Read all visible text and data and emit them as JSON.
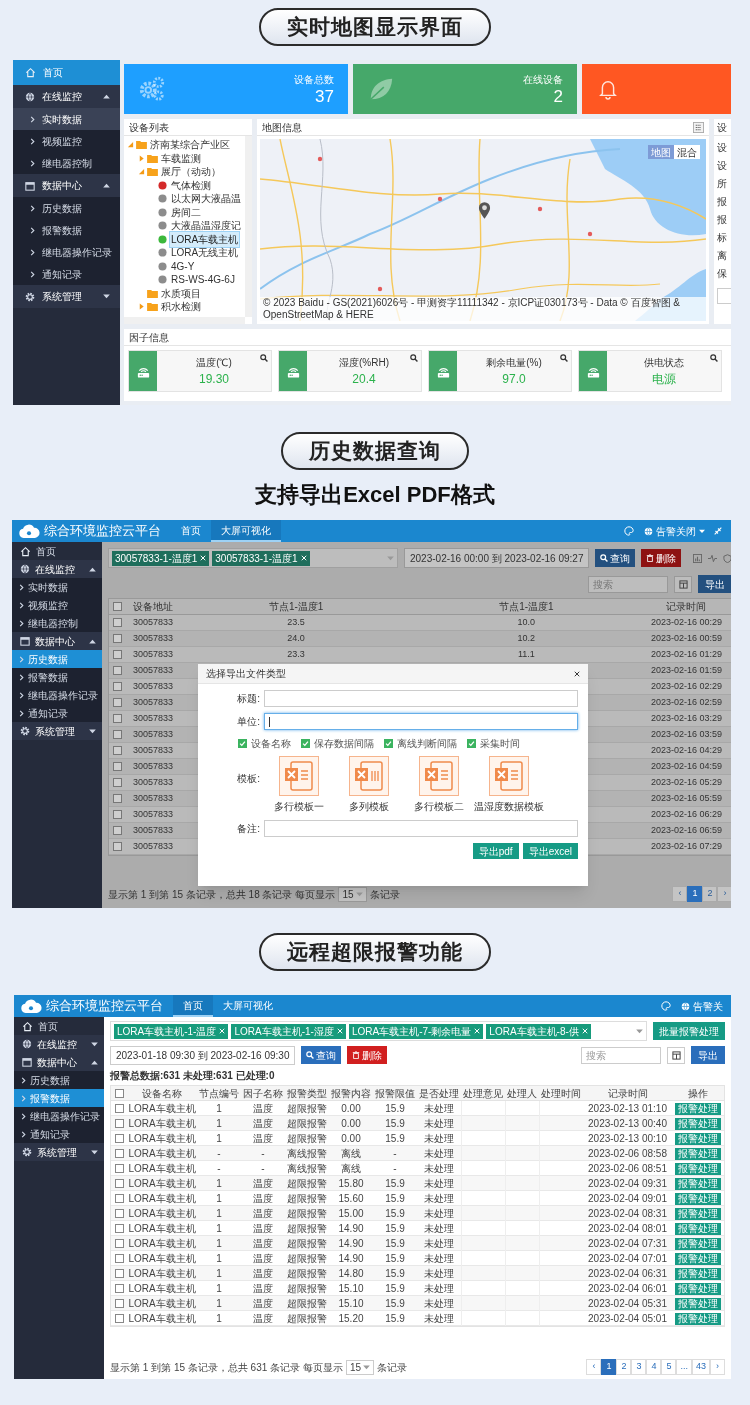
{
  "map_screen": {
    "heading": "实时地图显示界面",
    "sidebar": [
      {
        "kind": "link",
        "label": "首页"
      },
      {
        "kind": "group",
        "label": "在线监控",
        "expanded": true,
        "children": [
          {
            "label": "实时数据",
            "selected": true
          },
          {
            "label": "视频监控",
            "selected": false
          },
          {
            "label": "继电器控制",
            "selected": false
          }
        ]
      },
      {
        "kind": "group",
        "label": "数据中心",
        "expanded": true,
        "children": [
          {
            "label": "历史数据",
            "selected": false
          },
          {
            "label": "报警数据",
            "selected": false
          },
          {
            "label": "继电器操作记录",
            "selected": false
          },
          {
            "label": "通知记录",
            "selected": false
          }
        ]
      },
      {
        "kind": "group",
        "label": "系统管理",
        "expanded": false
      }
    ],
    "stats": [
      {
        "label": "设备总数",
        "value": "37",
        "color": "#1e9fff"
      },
      {
        "label": "在线设备",
        "value": "2",
        "color": "#46a86a"
      },
      {
        "color": "#ff5722"
      }
    ],
    "device_list": {
      "title": "设备列表",
      "tree": [
        {
          "kind": "folder",
          "label": "济南某综合产业区",
          "expanded": true,
          "children": [
            {
              "kind": "folder",
              "label": "车载监测",
              "expanded": false
            },
            {
              "kind": "folder",
              "label": "展厅（动动）",
              "expanded": true,
              "children": [
                {
                  "kind": "device",
                  "label": "气体检测",
                  "color": "#d42a2a",
                  "selected": false
                },
                {
                  "kind": "device",
                  "label": "以太网大液晶温",
                  "color": "#8c8c8c",
                  "selected": false
                },
                {
                  "kind": "device",
                  "label": "房间二",
                  "color": "#8c8c8c",
                  "selected": false
                },
                {
                  "kind": "device",
                  "label": "大液晶温湿度记",
                  "color": "#8c8c8c",
                  "selected": false
                },
                {
                  "kind": "device",
                  "label": "LORA车载主机",
                  "color": "#3cb83c",
                  "selected": true
                },
                {
                  "kind": "device",
                  "label": "LORA无线主机",
                  "color": "#8c8c8c",
                  "selected": false
                },
                {
                  "kind": "device",
                  "label": "4G-Y",
                  "color": "#8c8c8c",
                  "selected": false
                },
                {
                  "kind": "device",
                  "label": "RS-WS-4G-6J",
                  "color": "#8c8c8c",
                  "selected": false
                }
              ]
            },
            {
              "kind": "folder",
              "label": "水质项目"
            },
            {
              "kind": "folder",
              "label": "积水检测",
              "expanded": false
            }
          ]
        }
      ]
    },
    "map": {
      "title": "地图信息",
      "map_types": [
        {
          "label": "地图",
          "selected": true
        },
        {
          "label": "混合",
          "selected": false
        }
      ],
      "attribution": "© 2023 Baidu - GS(2021)6026号 - 甲测资字11111342 - 京ICP证030173号 - Data © 百度智图 & OpenStreetMap & HERE"
    },
    "detail_panel": {
      "title": "设",
      "labels": [
        "设",
        "设",
        "所",
        "报",
        "报",
        "标",
        "离",
        "保"
      ]
    },
    "factors": {
      "title": "因子信息",
      "cards": [
        {
          "label": "温度(℃)",
          "value": "19.30"
        },
        {
          "label": "湿度(%RH)",
          "value": "20.4"
        },
        {
          "label": "剩余电量(%)",
          "value": "97.0"
        },
        {
          "label": "供电状态",
          "value": "电源"
        }
      ]
    }
  },
  "history_screen": {
    "heading": "历史数据查询",
    "subtitle": "支持导出Excel PDF格式",
    "app_title": "综合环境监控云平台",
    "nav": [
      {
        "label": "首页",
        "selected": false
      },
      {
        "label": "大屏可视化",
        "selected": true
      }
    ],
    "alarm_toggle": "告警关闭",
    "sidebar": [
      {
        "kind": "link",
        "label": "首页"
      },
      {
        "kind": "group",
        "label": "在线监控",
        "expanded": true,
        "children": [
          {
            "label": "实时数据",
            "selected": false
          },
          {
            "label": "视频监控",
            "selected": false
          },
          {
            "label": "继电器控制",
            "selected": false
          }
        ]
      },
      {
        "kind": "group",
        "label": "数据中心",
        "expanded": true,
        "children": [
          {
            "label": "历史数据",
            "selected": true
          },
          {
            "label": "报警数据",
            "selected": false
          },
          {
            "label": "继电器操作记录",
            "selected": false
          },
          {
            "label": "通知记录",
            "selected": false
          }
        ]
      },
      {
        "kind": "group",
        "label": "系统管理",
        "expanded": false
      }
    ],
    "filter": {
      "tags": [
        "30057833-1-温度1",
        "30057833-1-温度1"
      ],
      "date_range": "2023-02-16 00:00 到 2023-02-16 09:27",
      "query_button": "查询",
      "delete_button": "删除"
    },
    "search": {
      "placeholder": "搜索"
    },
    "export_button": "导出",
    "table": {
      "select_all_checked": false,
      "columns": [
        "设备地址",
        "节点1-温度1",
        "节点1-温度1",
        "记录时间"
      ],
      "rows": [
        {
          "checked": false,
          "address": "30057833",
          "readings": [
            "23.5",
            "10.0"
          ],
          "time": "2023-02-16 00:29"
        },
        {
          "checked": false,
          "address": "30057833",
          "readings": [
            "24.0",
            "10.2"
          ],
          "time": "2023-02-16 00:59"
        },
        {
          "checked": false,
          "address": "30057833",
          "readings": [
            "23.3",
            "11.1"
          ],
          "time": "2023-02-16 01:29"
        },
        {
          "checked": false,
          "address": "30057833",
          "time": "2023-02-16 01:59"
        },
        {
          "checked": false,
          "address": "30057833",
          "time": "2023-02-16 02:29"
        },
        {
          "checked": false,
          "address": "30057833",
          "time": "2023-02-16 02:59"
        },
        {
          "checked": false,
          "address": "30057833",
          "time": "2023-02-16 03:29"
        },
        {
          "checked": false,
          "address": "30057833",
          "time": "2023-02-16 03:59"
        },
        {
          "checked": false,
          "address": "30057833",
          "time": "2023-02-16 04:29"
        },
        {
          "checked": false,
          "address": "30057833",
          "time": "2023-02-16 04:59"
        },
        {
          "checked": false,
          "address": "30057833",
          "time": "2023-02-16 05:29"
        },
        {
          "checked": false,
          "address": "30057833",
          "time": "2023-02-16 05:59"
        },
        {
          "checked": false,
          "address": "30057833",
          "time": "2023-02-16 06:29"
        },
        {
          "checked": false,
          "address": "30057833",
          "time": "2023-02-16 06:59"
        },
        {
          "checked": false,
          "address": "30057833",
          "time": "2023-02-16 07:29"
        }
      ]
    },
    "footer": {
      "summary": "显示第 1 到第 15 条记录，总共 18 条记录",
      "page_size_label": "每页显示",
      "page_size": "15",
      "page_size_suffix": "条记录",
      "pages": [
        {
          "label": "‹",
          "selected": false
        },
        {
          "label": "1",
          "selected": true
        },
        {
          "label": "2",
          "selected": false
        },
        {
          "label": "›",
          "selected": false
        }
      ]
    },
    "modal": {
      "title": "选择导出文件类型",
      "fields": [
        {
          "label": "标题:",
          "focused": false
        },
        {
          "label": "单位:",
          "focused": true
        }
      ],
      "options": [
        {
          "label": "设备名称",
          "checked": true
        },
        {
          "label": "保存数据间隔",
          "checked": true
        },
        {
          "label": "离线判断间隔",
          "checked": true
        },
        {
          "label": "采集时间",
          "checked": true
        }
      ],
      "template_label": "模板:",
      "templates": [
        "多行模板一",
        "多列模板",
        "多行模板二",
        "温湿度数据模板"
      ],
      "note_label": "备注:",
      "buttons": [
        "导出pdf",
        "导出excel"
      ]
    }
  },
  "alarm_screen": {
    "heading": "远程超限报警功能",
    "app_title": "综合环境监控云平台",
    "nav": [
      {
        "label": "首页",
        "selected": true
      },
      {
        "label": "大屏可视化",
        "selected": false
      }
    ],
    "alarm_toggle": "告警关",
    "sidebar": [
      {
        "kind": "link",
        "label": "首页"
      },
      {
        "kind": "group",
        "label": "在线监控",
        "expanded": false
      },
      {
        "kind": "group",
        "label": "数据中心",
        "expanded": true,
        "children": [
          {
            "label": "历史数据",
            "selected": false
          },
          {
            "label": "报警数据",
            "selected": true
          },
          {
            "label": "继电器操作记录",
            "selected": false
          },
          {
            "label": "通知记录",
            "selected": false
          }
        ]
      },
      {
        "kind": "group",
        "label": "系统管理",
        "expanded": false
      }
    ],
    "filter": {
      "tags": [
        "LORA车载主机-1-温度",
        "LORA车载主机-1-湿度",
        "LORA车载主机-7-剩余电量",
        "LORA车载主机-8-供"
      ],
      "date_range": "2023-01-18 09:30 到 2023-02-16 09:30",
      "query_button": "查询",
      "delete_button": "删除"
    },
    "batch_button": "批量报警处理",
    "totals": "报警总数据:631 未处理:631 已处理:0",
    "search": {
      "placeholder": "搜索"
    },
    "export_button": "导出",
    "table": {
      "select_all_checked": false,
      "columns": [
        "设备名称",
        "节点编号",
        "因子名称",
        "报警类型",
        "报警内容",
        "报警限值",
        "是否处理",
        "处理意见",
        "处理人",
        "处理时间",
        "记录时间",
        "操作"
      ],
      "rows": [
        {
          "checked": false,
          "device": "LORA车载主机",
          "node": "1",
          "factor": "温度",
          "type": "超限报警",
          "content": "0.00",
          "limit": "15.9",
          "status": "未处理",
          "time": "2023-02-13 01:10",
          "action": "报警处理"
        },
        {
          "checked": false,
          "device": "LORA车载主机",
          "node": "1",
          "factor": "温度",
          "type": "超限报警",
          "content": "0.00",
          "limit": "15.9",
          "status": "未处理",
          "time": "2023-02-13 00:40",
          "action": "报警处理"
        },
        {
          "checked": false,
          "device": "LORA车载主机",
          "node": "1",
          "factor": "温度",
          "type": "超限报警",
          "content": "0.00",
          "limit": "15.9",
          "status": "未处理",
          "time": "2023-02-13 00:10",
          "action": "报警处理"
        },
        {
          "checked": false,
          "device": "LORA车载主机",
          "node": "-",
          "factor": "-",
          "type": "离线报警",
          "content": "离线",
          "limit": "-",
          "status": "未处理",
          "time": "2023-02-06 08:58",
          "action": "报警处理"
        },
        {
          "checked": false,
          "device": "LORA车载主机",
          "node": "-",
          "factor": "-",
          "type": "离线报警",
          "content": "离线",
          "limit": "-",
          "status": "未处理",
          "time": "2023-02-06 08:51",
          "action": "报警处理"
        },
        {
          "checked": false,
          "device": "LORA车载主机",
          "node": "1",
          "factor": "温度",
          "type": "超限报警",
          "content": "15.80",
          "limit": "15.9",
          "status": "未处理",
          "time": "2023-02-04 09:31",
          "action": "报警处理"
        },
        {
          "checked": false,
          "device": "LORA车载主机",
          "node": "1",
          "factor": "温度",
          "type": "超限报警",
          "content": "15.60",
          "limit": "15.9",
          "status": "未处理",
          "time": "2023-02-04 09:01",
          "action": "报警处理"
        },
        {
          "checked": false,
          "device": "LORA车载主机",
          "node": "1",
          "factor": "温度",
          "type": "超限报警",
          "content": "15.00",
          "limit": "15.9",
          "status": "未处理",
          "time": "2023-02-04 08:31",
          "action": "报警处理"
        },
        {
          "checked": false,
          "device": "LORA车载主机",
          "node": "1",
          "factor": "温度",
          "type": "超限报警",
          "content": "14.90",
          "limit": "15.9",
          "status": "未处理",
          "time": "2023-02-04 08:01",
          "action": "报警处理"
        },
        {
          "checked": false,
          "device": "LORA车载主机",
          "node": "1",
          "factor": "温度",
          "type": "超限报警",
          "content": "14.90",
          "limit": "15.9",
          "status": "未处理",
          "time": "2023-02-04 07:31",
          "action": "报警处理"
        },
        {
          "checked": false,
          "device": "LORA车载主机",
          "node": "1",
          "factor": "温度",
          "type": "超限报警",
          "content": "14.90",
          "limit": "15.9",
          "status": "未处理",
          "time": "2023-02-04 07:01",
          "action": "报警处理"
        },
        {
          "checked": false,
          "device": "LORA车载主机",
          "node": "1",
          "factor": "温度",
          "type": "超限报警",
          "content": "14.80",
          "limit": "15.9",
          "status": "未处理",
          "time": "2023-02-04 06:31",
          "action": "报警处理"
        },
        {
          "checked": false,
          "device": "LORA车载主机",
          "node": "1",
          "factor": "温度",
          "type": "超限报警",
          "content": "15.10",
          "limit": "15.9",
          "status": "未处理",
          "time": "2023-02-04 06:01",
          "action": "报警处理"
        },
        {
          "checked": false,
          "device": "LORA车载主机",
          "node": "1",
          "factor": "温度",
          "type": "超限报警",
          "content": "15.10",
          "limit": "15.9",
          "status": "未处理",
          "time": "2023-02-04 05:31",
          "action": "报警处理"
        },
        {
          "checked": false,
          "device": "LORA车载主机",
          "node": "1",
          "factor": "温度",
          "type": "超限报警",
          "content": "15.20",
          "limit": "15.9",
          "status": "未处理",
          "time": "2023-02-04 05:01",
          "action": "报警处理"
        }
      ]
    },
    "footer": {
      "summary": "显示第 1 到第 15 条记录，总共 631 条记录",
      "page_size_label": "每页显示",
      "page_size": "15",
      "page_size_suffix": "条记录",
      "pages": [
        {
          "label": "‹",
          "selected": false
        },
        {
          "label": "1",
          "selected": true
        },
        {
          "label": "2",
          "selected": false
        },
        {
          "label": "3",
          "selected": false
        },
        {
          "label": "4",
          "selected": false
        },
        {
          "label": "5",
          "selected": false
        },
        {
          "label": "...",
          "selected": false
        },
        {
          "label": "43",
          "selected": false
        },
        {
          "label": "›",
          "selected": false
        }
      ]
    }
  }
}
